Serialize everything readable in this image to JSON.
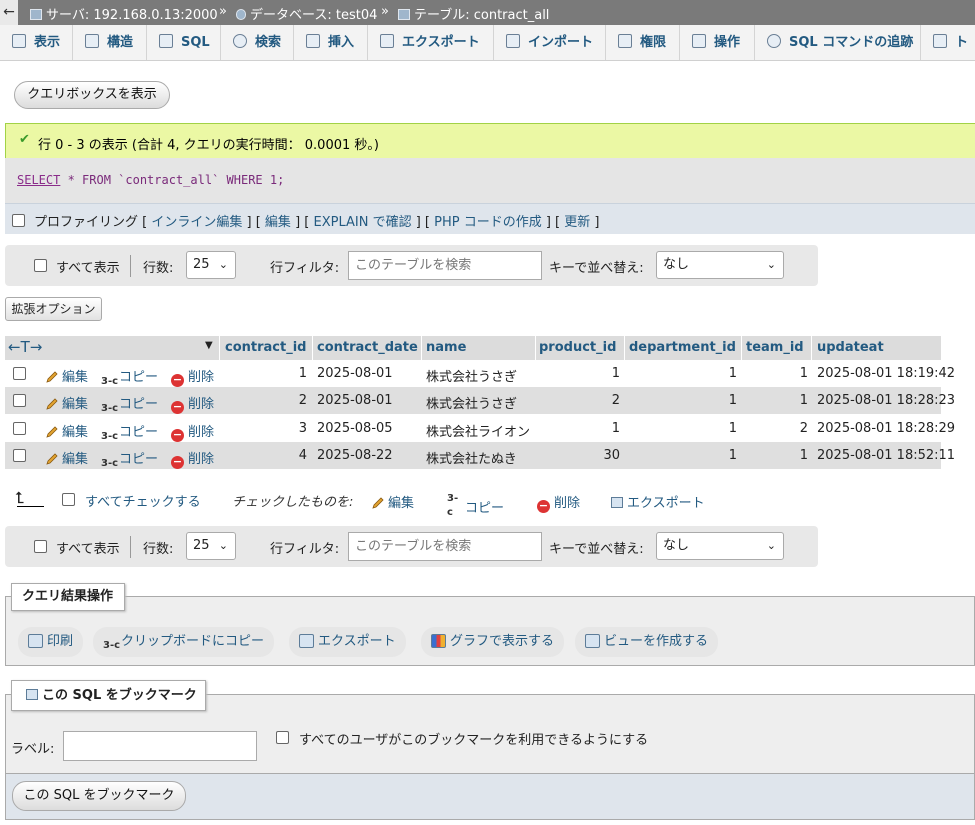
{
  "breadcrumb": {
    "back": "←",
    "server": "サーバ: 192.168.0.13:2000",
    "database": "データベース: test04",
    "table": "テーブル: contract_all",
    "separator": "»"
  },
  "tabs": [
    {
      "label": "表示",
      "icon": "browse-icon"
    },
    {
      "label": "構造",
      "icon": "structure-icon"
    },
    {
      "label": "SQL",
      "icon": "sql-icon"
    },
    {
      "label": "検索",
      "icon": "search-icon"
    },
    {
      "label": "挿入",
      "icon": "insert-icon"
    },
    {
      "label": "エクスポート",
      "icon": "export-icon"
    },
    {
      "label": "インポート",
      "icon": "import-icon"
    },
    {
      "label": "権限",
      "icon": "privileges-icon"
    },
    {
      "label": "操作",
      "icon": "wrench-icon"
    },
    {
      "label": "SQL コマンドの追跡",
      "icon": "eye-icon"
    },
    {
      "label": "ト",
      "icon": "triggers-icon"
    }
  ],
  "query_box_button": "クエリボックスを表示",
  "success_message": "行 0 - 3 の表示 (合計 4, クエリの実行時間： 0.0001 秒。)",
  "sql": {
    "keyword_select": "SELECT",
    "rest": " * FROM `contract_all` WHERE 1;"
  },
  "profiling": {
    "label": "プロファイリング",
    "links": [
      "インライン編集",
      "編集",
      "EXPLAIN で確認",
      "PHP コードの作成",
      "更新"
    ]
  },
  "nav": {
    "show_all": "すべて表示",
    "rows_label": "行数:",
    "rows_value": "25",
    "filter_label": "行フィルタ:",
    "filter_placeholder": "このテーブルを検索",
    "sort_label": "キーで並べ替え:",
    "sort_value": "なし"
  },
  "extended_options": "拡張オプション",
  "table": {
    "columns": [
      "contract_id",
      "contract_date",
      "name",
      "product_id",
      "department_id",
      "team_id",
      "updateat"
    ],
    "actions": {
      "edit": "編集",
      "copy": "コピー",
      "delete": "削除"
    },
    "rows": [
      {
        "contract_id": "1",
        "contract_date": "2025-08-01",
        "name": "株式会社うさぎ",
        "product_id": "1",
        "department_id": "1",
        "team_id": "1",
        "updateat": "2025-08-01 18:19:42"
      },
      {
        "contract_id": "2",
        "contract_date": "2025-08-01",
        "name": "株式会社うさぎ",
        "product_id": "2",
        "department_id": "1",
        "team_id": "1",
        "updateat": "2025-08-01 18:28:23"
      },
      {
        "contract_id": "3",
        "contract_date": "2025-08-05",
        "name": "株式会社ライオン",
        "product_id": "1",
        "department_id": "1",
        "team_id": "2",
        "updateat": "2025-08-01 18:28:29"
      },
      {
        "contract_id": "4",
        "contract_date": "2025-08-22",
        "name": "株式会社たぬき",
        "product_id": "30",
        "department_id": "1",
        "team_id": "1",
        "updateat": "2025-08-01 18:52:11"
      }
    ]
  },
  "bulk": {
    "check_all": "すべてチェックする",
    "with_selected": "チェックしたものを:",
    "edit": "編集",
    "copy": "コピー",
    "delete": "削除",
    "export": "エクスポート"
  },
  "query_ops": {
    "legend": "クエリ結果操作",
    "print": "印刷",
    "clipboard": "クリップボードにコピー",
    "export": "エクスポート",
    "chart": "グラフで表示する",
    "view": "ビューを作成する"
  },
  "bookmark": {
    "legend": "この SQL をブックマーク",
    "label": "ラベル:",
    "shared": "すべてのユーザがこのブックマークを利用できるようにする",
    "submit": "この SQL をブックマーク"
  },
  "colors": {
    "link": "#235a81",
    "success_bg": "#ebf8a4",
    "delete": "#dd3333"
  }
}
